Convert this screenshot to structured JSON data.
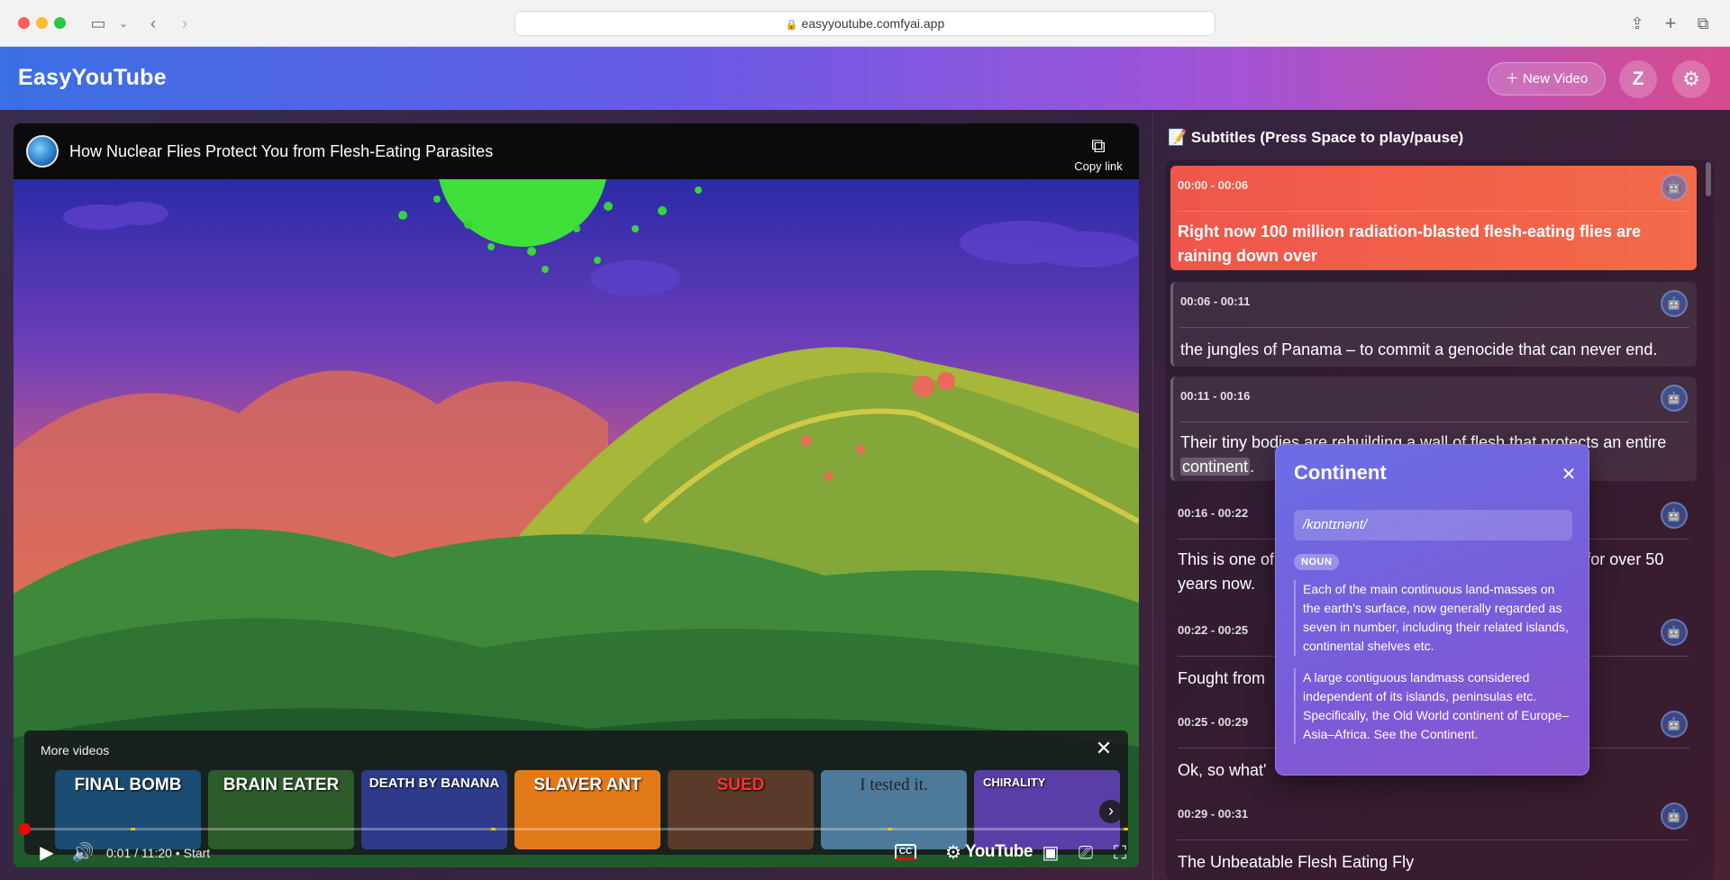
{
  "browser": {
    "url": "easyyoutube.comfyai.app"
  },
  "app": {
    "brand": "EasyYouTube",
    "new_video_label": "New Video",
    "avatar_initial": "Z"
  },
  "player": {
    "title": "How Nuclear Flies Protect You from Flesh-Eating Parasites",
    "copy_link_label": "Copy link",
    "more_videos_label": "More videos",
    "thumbnails": [
      {
        "label": "FINAL BOMB",
        "bg": "#1b4d74"
      },
      {
        "label": "BRAIN EATER",
        "bg": "#2d5b2a"
      },
      {
        "label": "DEATH BY BANANA",
        "bg": "#2e3b8a"
      },
      {
        "label": "SLAVER ANT",
        "bg": "#e27a1a"
      },
      {
        "label": "SUED",
        "bg": "#5a3a2a"
      },
      {
        "label": "I tested it.",
        "bg": "#4d7a9a"
      },
      {
        "label": "CHIRALITY",
        "bg": "#5a3ea8"
      }
    ],
    "time_current": "0:01",
    "time_total": "11:20",
    "chapter_label": "Start",
    "progress_fraction": 0.0015,
    "youtube_label": "YouTube",
    "cc_label": "CC"
  },
  "subtitles": {
    "header": "📝 Subtitles (Press Space to play/pause)",
    "items": [
      {
        "time": "00:00 - 00:06",
        "text": "Right now 100 million radiation-blasted  flesh-eating flies are raining down over"
      },
      {
        "time": "00:06 - 00:11",
        "text": "the jungles of Panama – to commit a genocide that can never end."
      },
      {
        "time": "00:11 - 00:16",
        "text_before": "Their tiny bodies are rebuilding a wall of  flesh that protects an entire ",
        "highlight": "continent",
        "text_after": "."
      },
      {
        "time": "00:16 - 00:22",
        "text": "This is one of the greatest  engineering projects going on for over 50 years now."
      },
      {
        "time": "00:22 - 00:25",
        "text": "Fought from"
      },
      {
        "time": "00:25 - 00:29",
        "text": "Ok, so what'"
      },
      {
        "time": "00:29 - 00:31",
        "text": "The Unbeatable Flesh Eating Fly"
      }
    ]
  },
  "dictionary": {
    "word": "Continent",
    "phonetic": "/kɒntɪnənt/",
    "part_of_speech": "NOUN",
    "definitions": [
      "Each of the main continuous land-masses on the earth's surface, now generally regarded as seven in number, including their related islands, continental shelves etc.",
      "A large contiguous landmass considered independent of its islands, peninsulas etc. Specifically, the Old World continent of Europe–Asia–Africa. See the Continent."
    ]
  }
}
